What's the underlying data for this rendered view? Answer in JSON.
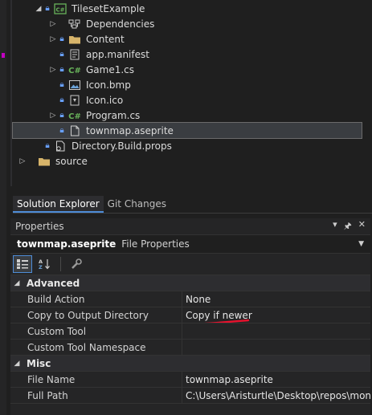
{
  "solution_tree": {
    "items": [
      {
        "label": "TilesetExample",
        "kind": "csproj"
      },
      {
        "label": "Dependencies",
        "kind": "dependencies"
      },
      {
        "label": "Content",
        "kind": "folder"
      },
      {
        "label": "app.manifest",
        "kind": "manifest"
      },
      {
        "label": "Game1.cs",
        "kind": "csharp"
      },
      {
        "label": "Icon.bmp",
        "kind": "image"
      },
      {
        "label": "Icon.ico",
        "kind": "icon-file"
      },
      {
        "label": "Program.cs",
        "kind": "csharp"
      },
      {
        "label": "townmap.aseprite",
        "kind": "file",
        "selected": true
      },
      {
        "label": "Directory.Build.props",
        "kind": "props"
      },
      {
        "label": "source",
        "kind": "folder"
      }
    ]
  },
  "tabs": [
    "Solution Explorer",
    "Git Changes"
  ],
  "properties_panel": {
    "title": "Properties",
    "object_name": "townmap.aseprite",
    "object_type": "File Properties",
    "categories": [
      {
        "name": "Advanced",
        "rows": [
          {
            "name": "Build Action",
            "value": "None"
          },
          {
            "name": "Copy to Output Directory",
            "value": "Copy if newer"
          },
          {
            "name": "Custom Tool",
            "value": ""
          },
          {
            "name": "Custom Tool Namespace",
            "value": ""
          }
        ]
      },
      {
        "name": "Misc",
        "rows": [
          {
            "name": "File Name",
            "value": "townmap.aseprite"
          },
          {
            "name": "Full Path",
            "value": "C:\\Users\\Aristurtle\\Desktop\\repos\\monog"
          }
        ]
      }
    ]
  },
  "colors": {
    "background": "#1f1f1f",
    "panel": "#252526",
    "selection": "#3a3d41",
    "accent": "#4e8cd7",
    "annotation": "#e8112d",
    "csharp": "#68b35a",
    "folder": "#d7b46a"
  }
}
